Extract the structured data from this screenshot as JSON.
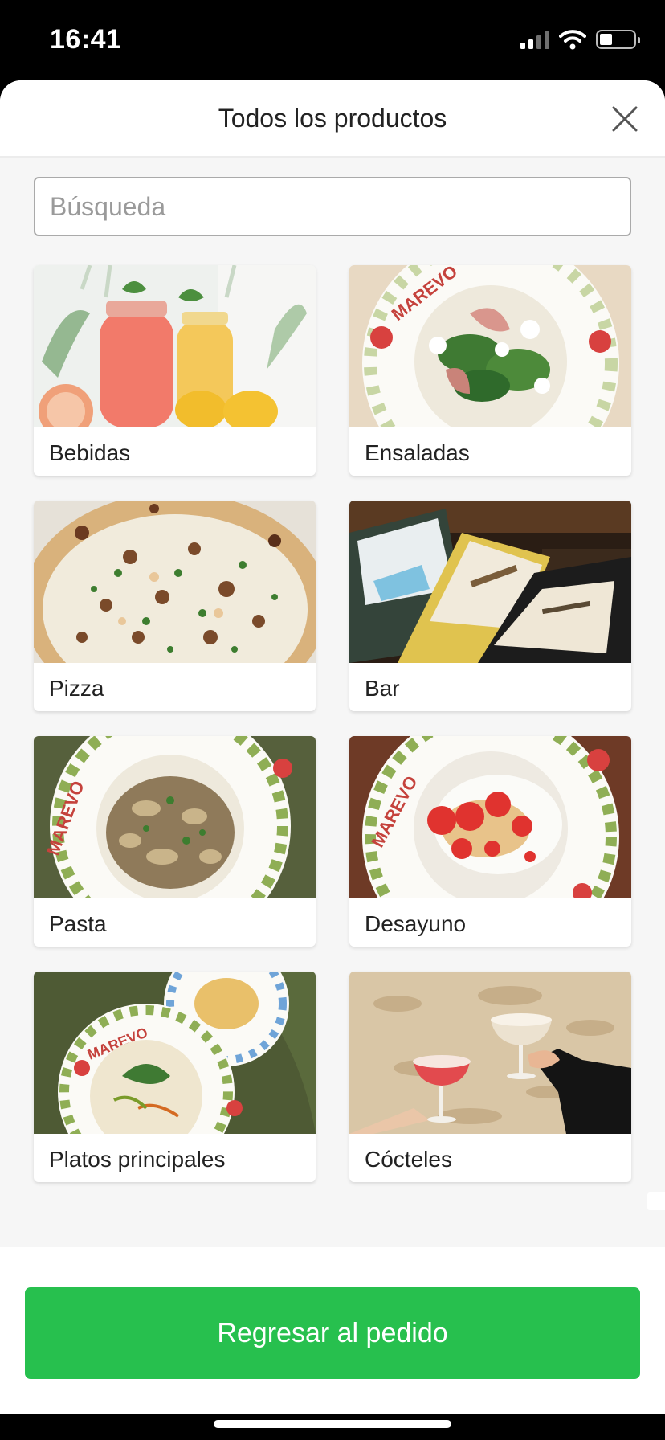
{
  "status_bar": {
    "time": "16:41",
    "battery_level": 0.3,
    "signal_bars": 2
  },
  "sheet": {
    "title": "Todos los productos",
    "close_icon": "close-icon"
  },
  "search": {
    "placeholder": "Búsqueda",
    "value": ""
  },
  "categories": [
    {
      "label": "Bebidas",
      "image": "lemonade-jars-image"
    },
    {
      "label": "Ensaladas",
      "image": "salad-plate-image"
    },
    {
      "label": "Pizza",
      "image": "pizza-image"
    },
    {
      "label": "Bar",
      "image": "wine-bottles-image"
    },
    {
      "label": "Pasta",
      "image": "pasta-plate-image"
    },
    {
      "label": "Desayuno",
      "image": "breakfast-plate-image"
    },
    {
      "label": "Platos principales",
      "image": "soup-plates-image"
    },
    {
      "label": "Cócteles",
      "image": "cocktail-glasses-image"
    }
  ],
  "plate_brand": "MAREVO",
  "footer": {
    "button_label": "Regresar al pedido"
  },
  "colors": {
    "primary": "#27c04e",
    "background": "#f6f6f6"
  }
}
